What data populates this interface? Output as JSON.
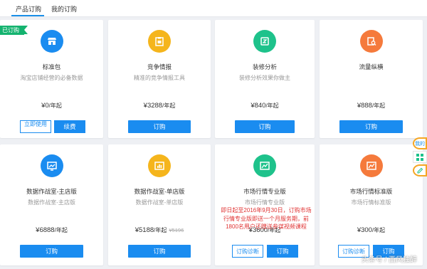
{
  "tabs": [
    {
      "label": "产品订购",
      "active": true
    },
    {
      "label": "我的订购",
      "active": false
    }
  ],
  "badge": "已订购",
  "cards": [
    {
      "title": "标准包",
      "desc": "淘宝店铺经营的必备数据",
      "price": "¥0",
      "unit": "/年起",
      "icon": "shop-icon",
      "color": "#1a8cf0",
      "buttons": [
        "立即使用",
        "续费"
      ]
    },
    {
      "title": "竞争情报",
      "desc": "精准的竞争情报工具",
      "price": "¥3288",
      "unit": "/年起",
      "icon": "clipboard-icon",
      "color": "#f5b51c",
      "buttons": [
        "订购"
      ]
    },
    {
      "title": "装修分析",
      "desc": "装修分析效果你做主",
      "price": "¥840",
      "unit": "/年起",
      "icon": "decor-analysis-icon",
      "color": "#1ec28b",
      "buttons": [
        "订购"
      ]
    },
    {
      "title": "流量纵横",
      "desc": "",
      "price": "¥888",
      "unit": "/年起",
      "icon": "document-search-icon",
      "color": "#f57a3c",
      "buttons": [
        "订购"
      ]
    },
    {
      "title": "数据作战室-主店版",
      "desc": "数据作战室-主店版",
      "price": "¥6888",
      "unit": "/年起",
      "icon": "monitor-chart-icon",
      "color": "#1a8cf0",
      "buttons": [
        "订购"
      ]
    },
    {
      "title": "数据作战室-单店版",
      "desc": "数据作战室-单店版",
      "price": "¥5188",
      "unit": "/年起",
      "old": "¥5196",
      "icon": "bar-chart-icon",
      "color": "#f5b51c",
      "buttons": [
        "订购"
      ]
    },
    {
      "title": "市场行情专业版",
      "desc": "市场行情专业版",
      "price": "¥3600",
      "unit": "/年起",
      "icon": "trend-chart-icon",
      "color": "#1ec28b",
      "buttons": [
        "订购诊断",
        "订购"
      ]
    },
    {
      "title": "市场行情标准版",
      "desc": "市场行情标准版",
      "price": "¥300",
      "unit": "/年起",
      "icon": "trend-chart-icon",
      "color": "#f57a3c",
      "buttons": [
        "订购诊断",
        "订购"
      ]
    }
  ],
  "notice": "即日起至2016年9月30日，订购市场行情专业版即送一个月服务期，前1800名用户还赠送参谋视频课程",
  "side_tools": [
    "我的",
    "grid-icon",
    "edit-icon"
  ],
  "watermark": "头条号 / 西风独醉"
}
